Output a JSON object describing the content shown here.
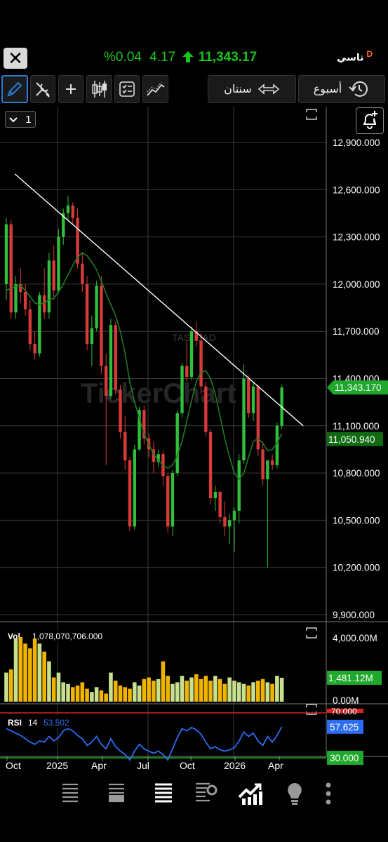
{
  "header": {
    "close_label": "✕",
    "change_pct": "%0.04",
    "change": "4.17",
    "last": "11,343.17",
    "ticker": "تاسي",
    "ticker_flag": "D"
  },
  "toolbar": {
    "range_label": "سنتان",
    "period_label": "أسبوع"
  },
  "scale_button": {
    "value": "1"
  },
  "watermark": {
    "symbol": "TASI.SAD",
    "brand": "TickerChart"
  },
  "price_panel": {
    "price_ticks": [
      "12,900.000",
      "12,600.000",
      "12,300.000",
      "12,000.000",
      "11,700.000",
      "11,400.000",
      "11,100.000",
      "10,800.000",
      "10,500.000",
      "10,200.000",
      "9,900.000"
    ],
    "last_label": "11,343.170",
    "ma_label": "11,050.940"
  },
  "volume_panel": {
    "name": "Vol",
    "value": "1,078,070,706.000",
    "ticks": [
      "4,000.00M",
      "0.00M"
    ],
    "last_label": "1,481.12M"
  },
  "rsi_panel": {
    "name": "RSI",
    "period": "14",
    "value": "53.502",
    "ticks": [
      "70.000"
    ],
    "last_label": "57.625",
    "low_label": "30.000"
  },
  "x_axis": [
    "Oct",
    "2025",
    "Apr",
    "Jul",
    "Oct",
    "2026",
    "Apr"
  ],
  "colors": {
    "up": "#2fbf3a",
    "down": "#d83a3a",
    "ma": "#1e7a25",
    "vol_up": "#c7e08f",
    "vol_down": "#f0b400",
    "rsi": "#2c6cf2",
    "rsi_high": "#d22",
    "rsi_low": "#1db31d",
    "last_bg": "#1fa82b"
  },
  "chart_data": {
    "type": "candlestick",
    "interval": "week",
    "ylim": [
      9900,
      13000
    ],
    "candles": [
      {
        "o": 12000,
        "h": 12420,
        "l": 11900,
        "c": 12380
      },
      {
        "o": 12380,
        "h": 12410,
        "l": 11780,
        "c": 11820
      },
      {
        "o": 11820,
        "h": 12050,
        "l": 11780,
        "c": 12000
      },
      {
        "o": 12000,
        "h": 12100,
        "l": 11880,
        "c": 11950
      },
      {
        "o": 11950,
        "h": 12000,
        "l": 11800,
        "c": 11840
      },
      {
        "o": 11840,
        "h": 11900,
        "l": 11580,
        "c": 11620
      },
      {
        "o": 11620,
        "h": 11700,
        "l": 11520,
        "c": 11560
      },
      {
        "o": 11560,
        "h": 11950,
        "l": 11540,
        "c": 11930
      },
      {
        "o": 11930,
        "h": 12100,
        "l": 11780,
        "c": 11820
      },
      {
        "o": 11820,
        "h": 12200,
        "l": 11780,
        "c": 12150
      },
      {
        "o": 12150,
        "h": 12250,
        "l": 11900,
        "c": 11960
      },
      {
        "o": 11960,
        "h": 12350,
        "l": 11940,
        "c": 12300
      },
      {
        "o": 12300,
        "h": 12480,
        "l": 12250,
        "c": 12450
      },
      {
        "o": 12450,
        "h": 12560,
        "l": 12400,
        "c": 12500
      },
      {
        "o": 12500,
        "h": 12520,
        "l": 12380,
        "c": 12420
      },
      {
        "o": 12420,
        "h": 12480,
        "l": 12100,
        "c": 12130
      },
      {
        "o": 12130,
        "h": 12200,
        "l": 11950,
        "c": 12000
      },
      {
        "o": 12000,
        "h": 12050,
        "l": 11580,
        "c": 11620
      },
      {
        "o": 11620,
        "h": 11800,
        "l": 11480,
        "c": 11720
      },
      {
        "o": 11720,
        "h": 12020,
        "l": 11700,
        "c": 11990
      },
      {
        "o": 11990,
        "h": 12050,
        "l": 11430,
        "c": 11480
      },
      {
        "o": 11480,
        "h": 11560,
        "l": 10850,
        "c": 11290
      },
      {
        "o": 11290,
        "h": 11780,
        "l": 11270,
        "c": 11740
      },
      {
        "o": 11740,
        "h": 11760,
        "l": 11300,
        "c": 11330
      },
      {
        "o": 11330,
        "h": 11360,
        "l": 11020,
        "c": 11060
      },
      {
        "o": 11060,
        "h": 11160,
        "l": 10820,
        "c": 10880
      },
      {
        "o": 10880,
        "h": 10900,
        "l": 10430,
        "c": 10460
      },
      {
        "o": 10460,
        "h": 10980,
        "l": 10440,
        "c": 10950
      },
      {
        "o": 10950,
        "h": 11220,
        "l": 10940,
        "c": 11200
      },
      {
        "o": 11200,
        "h": 11230,
        "l": 10980,
        "c": 11020
      },
      {
        "o": 11020,
        "h": 11050,
        "l": 10900,
        "c": 10950
      },
      {
        "o": 10950,
        "h": 11000,
        "l": 10800,
        "c": 10870
      },
      {
        "o": 10870,
        "h": 10950,
        "l": 10840,
        "c": 10920
      },
      {
        "o": 10920,
        "h": 10940,
        "l": 10720,
        "c": 10780
      },
      {
        "o": 10780,
        "h": 10800,
        "l": 10420,
        "c": 10460
      },
      {
        "o": 10460,
        "h": 10820,
        "l": 10400,
        "c": 10800
      },
      {
        "o": 10800,
        "h": 11200,
        "l": 10780,
        "c": 11180
      },
      {
        "o": 11180,
        "h": 11500,
        "l": 11150,
        "c": 11480
      },
      {
        "o": 11480,
        "h": 11640,
        "l": 11380,
        "c": 11410
      },
      {
        "o": 11410,
        "h": 11730,
        "l": 11390,
        "c": 11700
      },
      {
        "o": 11700,
        "h": 11760,
        "l": 11600,
        "c": 11640
      },
      {
        "o": 11640,
        "h": 11690,
        "l": 11300,
        "c": 11350
      },
      {
        "o": 11350,
        "h": 11380,
        "l": 11030,
        "c": 11060
      },
      {
        "o": 11060,
        "h": 11080,
        "l": 10600,
        "c": 10640
      },
      {
        "o": 10640,
        "h": 10720,
        "l": 10560,
        "c": 10680
      },
      {
        "o": 10680,
        "h": 10690,
        "l": 10480,
        "c": 10520
      },
      {
        "o": 10520,
        "h": 10620,
        "l": 10400,
        "c": 10460
      },
      {
        "o": 10460,
        "h": 10540,
        "l": 10350,
        "c": 10500
      },
      {
        "o": 10500,
        "h": 10580,
        "l": 10300,
        "c": 10560
      },
      {
        "o": 10560,
        "h": 10920,
        "l": 10480,
        "c": 10880
      },
      {
        "o": 10880,
        "h": 11490,
        "l": 10860,
        "c": 11400
      },
      {
        "o": 11400,
        "h": 11420,
        "l": 11150,
        "c": 11180
      },
      {
        "o": 11180,
        "h": 11380,
        "l": 11130,
        "c": 11350
      },
      {
        "o": 11350,
        "h": 11360,
        "l": 10910,
        "c": 10950
      },
      {
        "o": 10950,
        "h": 11000,
        "l": 10720,
        "c": 10760
      },
      {
        "o": 10760,
        "h": 10790,
        "l": 10200,
        "c": 10880
      },
      {
        "o": 10880,
        "h": 10920,
        "l": 10820,
        "c": 10850
      },
      {
        "o": 10850,
        "h": 11120,
        "l": 10830,
        "c": 11100
      },
      {
        "o": 11100,
        "h": 11360,
        "l": 11080,
        "c": 11343.17
      }
    ],
    "moving_average": [
      11960,
      11975,
      11985,
      11990,
      11960,
      11920,
      11880,
      11870,
      11880,
      11900,
      11910,
      11950,
      12000,
      12060,
      12120,
      12170,
      12200,
      12180,
      12140,
      12090,
      12020,
      11940,
      11870,
      11800,
      11700,
      11560,
      11380,
      11250,
      11150,
      11050,
      10980,
      10920,
      10880,
      10850,
      10830,
      10850,
      10910,
      11000,
      11130,
      11260,
      11380,
      11440,
      11450,
      11400,
      11300,
      11160,
      11020,
      10900,
      10800,
      10760,
      10800,
      10900,
      11000,
      11020,
      10990,
      10940,
      10950,
      10990,
      11050.94
    ],
    "trendline": {
      "from": {
        "index": 1.8,
        "price": 12700
      },
      "to": {
        "index": 62.5,
        "price": 11100
      }
    },
    "volume_millions": [
      1800,
      2000,
      3900,
      4000,
      3600,
      3300,
      3900,
      3600,
      3100,
      2500,
      1500,
      1800,
      1200,
      1100,
      900,
      1000,
      1200,
      800,
      600,
      900,
      700,
      500,
      1800,
      1300,
      1000,
      900,
      800,
      1200,
      1000,
      1400,
      1500,
      1300,
      1400,
      2500,
      1600,
      1100,
      1200,
      1600,
      1300,
      1500,
      1700,
      1400,
      1600,
      1300,
      1600,
      1400,
      1100,
      1500,
      1300,
      1200,
      1100,
      1000,
      1200,
      1300,
      1400,
      1200,
      1100,
      1600,
      1481.12
    ],
    "volume_up": [
      1,
      0,
      1,
      0,
      0,
      0,
      0,
      1,
      0,
      1,
      0,
      1,
      1,
      1,
      0,
      0,
      0,
      0,
      1,
      1,
      0,
      0,
      1,
      0,
      0,
      0,
      0,
      1,
      1,
      0,
      0,
      0,
      1,
      0,
      0,
      1,
      1,
      1,
      0,
      1,
      0,
      0,
      0,
      0,
      1,
      0,
      0,
      1,
      1,
      1,
      1,
      0,
      1,
      0,
      0,
      1,
      0,
      1,
      1
    ],
    "rsi": [
      56,
      54,
      52,
      50,
      47,
      44,
      42,
      45,
      44,
      49,
      45,
      48,
      54,
      56,
      54,
      50,
      47,
      41,
      44,
      49,
      42,
      38,
      47,
      40,
      36,
      33,
      28,
      36,
      42,
      38,
      36,
      34,
      36,
      33,
      28,
      38,
      48,
      56,
      54,
      57,
      55,
      51,
      44,
      38,
      40,
      37,
      36,
      37,
      39,
      45,
      53,
      49,
      52,
      45,
      41,
      49,
      44,
      50,
      57.625
    ],
    "x_ticks": [
      "Oct",
      "2025",
      "Apr",
      "Jul",
      "Oct",
      "2026",
      "Apr"
    ]
  }
}
